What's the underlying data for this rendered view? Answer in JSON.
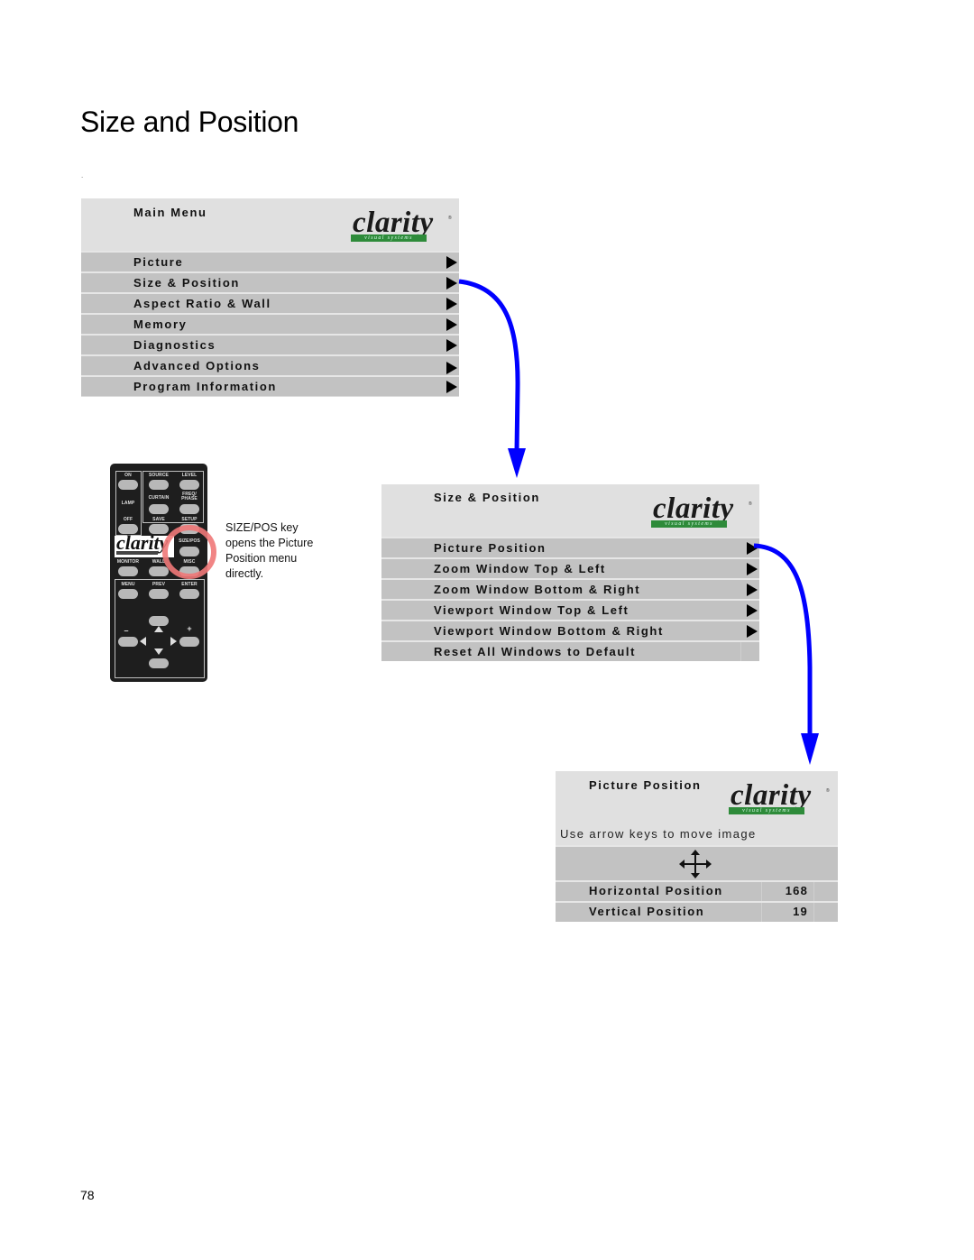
{
  "page": {
    "title": "Size and Position",
    "dot": ".",
    "page_number": "78"
  },
  "logo": {
    "word": "clarity",
    "tagline": "visual systems",
    "brand_green": "#2e8b3a"
  },
  "main_menu": {
    "title": "Main Menu",
    "items": [
      {
        "label": "Picture",
        "icon": "submenu-arrow-icon"
      },
      {
        "label": "Size & Position",
        "icon": "submenu-arrow-icon"
      },
      {
        "label": "Aspect Ratio & Wall",
        "icon": "submenu-arrow-icon"
      },
      {
        "label": "Memory",
        "icon": "submenu-arrow-icon"
      },
      {
        "label": "Diagnostics",
        "icon": "submenu-arrow-icon"
      },
      {
        "label": "Advanced Options",
        "icon": "submenu-arrow-icon"
      },
      {
        "label": "Program Information",
        "icon": "submenu-arrow-icon"
      }
    ]
  },
  "size_position_menu": {
    "title": "Size & Position",
    "items": [
      {
        "label": "Picture Position",
        "icon": "submenu-arrow-icon"
      },
      {
        "label": "Zoom Window Top & Left",
        "icon": "submenu-arrow-icon"
      },
      {
        "label": "Zoom Window Bottom & Right",
        "icon": "submenu-arrow-icon"
      },
      {
        "label": "Viewport Window Top & Left",
        "icon": "submenu-arrow-icon"
      },
      {
        "label": "Viewport Window Bottom & Right",
        "icon": "submenu-arrow-icon"
      },
      {
        "label": "Reset All Windows to Default",
        "icon": null
      }
    ]
  },
  "picture_position_menu": {
    "title": "Picture Position",
    "hint": "Use arrow keys to move image",
    "move_icon": "four-way-move-icon",
    "rows": [
      {
        "label": "Horizontal Position",
        "value": "168"
      },
      {
        "label": "Vertical Position",
        "value": "19"
      }
    ]
  },
  "remote": {
    "buttons": {
      "on": "ON",
      "lamp": "LAMP",
      "off": "OFF",
      "source": "SOURCE",
      "level": "LEVEL",
      "curtain": "CURTAIN",
      "freq_phase": "FREQ/ PHASE",
      "save": "SAVE",
      "setup": "SETUP",
      "size_pos": "SIZE/POS",
      "monitor": "MONITOR",
      "wall": "WALL",
      "misc": "MISC",
      "menu": "MENU",
      "prev": "PREV",
      "enter": "ENTER",
      "minus": "–",
      "plus": "+"
    },
    "logo_word": "clarity",
    "highlight_color": "#f07878",
    "caption_lines": [
      "SIZE/POS key",
      "opens the Picture",
      "Position menu",
      "directly."
    ]
  },
  "flow_arrow_color": "#0000ff"
}
